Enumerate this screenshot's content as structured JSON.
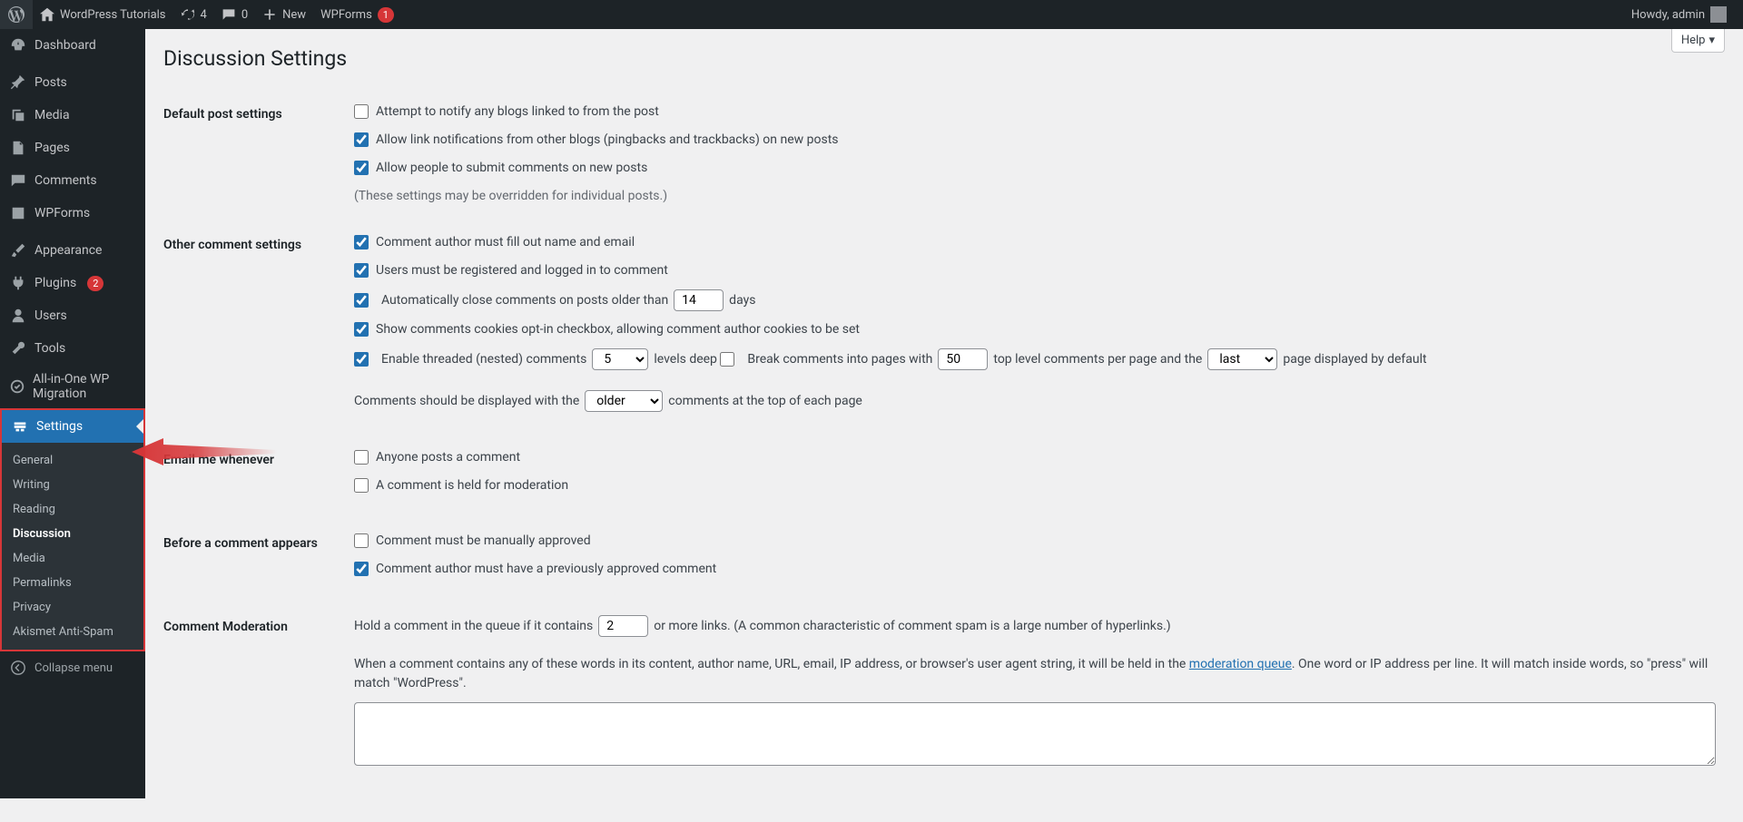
{
  "adminbar": {
    "site_title": "WordPress Tutorials",
    "updates_count": "4",
    "comments_count": "0",
    "new_label": "New",
    "wpforms_label": "WPForms",
    "wpforms_badge": "1",
    "howdy": "Howdy, admin"
  },
  "sidebar": {
    "items": [
      {
        "label": "Dashboard"
      },
      {
        "label": "Posts"
      },
      {
        "label": "Media"
      },
      {
        "label": "Pages"
      },
      {
        "label": "Comments"
      },
      {
        "label": "WPForms"
      },
      {
        "label": "Appearance"
      },
      {
        "label": "Plugins",
        "badge": "2"
      },
      {
        "label": "Users"
      },
      {
        "label": "Tools"
      },
      {
        "label": "All-in-One WP Migration"
      },
      {
        "label": "Settings"
      }
    ],
    "submenu": [
      {
        "label": "General"
      },
      {
        "label": "Writing"
      },
      {
        "label": "Reading"
      },
      {
        "label": "Discussion"
      },
      {
        "label": "Media"
      },
      {
        "label": "Permalinks"
      },
      {
        "label": "Privacy"
      },
      {
        "label": "Akismet Anti-Spam"
      }
    ],
    "collapse": "Collapse menu"
  },
  "content": {
    "help_label": "Help",
    "page_title": "Discussion Settings",
    "sections": {
      "default_post": {
        "heading": "Default post settings",
        "opt1": "Attempt to notify any blogs linked to from the post",
        "opt2": "Allow link notifications from other blogs (pingbacks and trackbacks) on new posts",
        "opt3": "Allow people to submit comments on new posts",
        "hint": "(These settings may be overridden for individual posts.)"
      },
      "other_comment": {
        "heading": "Other comment settings",
        "opt1": "Comment author must fill out name and email",
        "opt2": "Users must be registered and logged in to comment",
        "opt3_pre": "Automatically close comments on posts older than",
        "opt3_value": "14",
        "opt3_post": "days",
        "opt4": "Show comments cookies opt-in checkbox, allowing comment author cookies to be set",
        "opt5_pre": "Enable threaded (nested) comments",
        "opt5_value": "5",
        "opt5_post": "levels deep",
        "opt6_pre": "Break comments into pages with",
        "opt6_value": "50",
        "opt6_mid": "top level comments per page and the",
        "opt6_sel": "last",
        "opt6_post": "page displayed by default",
        "opt7_pre": "Comments should be displayed with the",
        "opt7_sel": "older",
        "opt7_post": "comments at the top of each page"
      },
      "email_me": {
        "heading": "Email me whenever",
        "opt1": "Anyone posts a comment",
        "opt2": "A comment is held for moderation"
      },
      "before_appears": {
        "heading": "Before a comment appears",
        "opt1": "Comment must be manually approved",
        "opt2": "Comment author must have a previously approved comment"
      },
      "moderation": {
        "heading": "Comment Moderation",
        "pre": "Hold a comment in the queue if it contains",
        "value": "2",
        "post": "or more links. (A common characteristic of comment spam is a large number of hyperlinks.)",
        "desc_pre": "When a comment contains any of these words in its content, author name, URL, email, IP address, or browser's user agent string, it will be held in the ",
        "desc_link": "moderation queue",
        "desc_post": ". One word or IP address per line. It will match inside words, so \"press\" will match \"WordPress\"."
      }
    }
  }
}
